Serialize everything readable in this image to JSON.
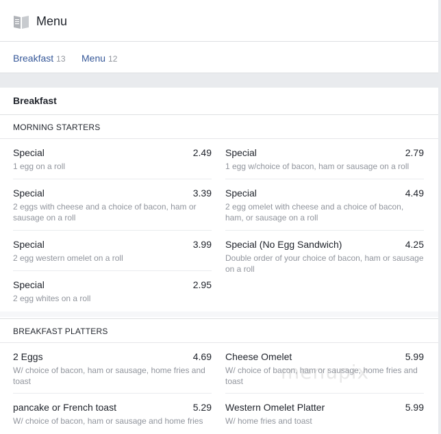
{
  "header": {
    "title": "Menu",
    "icon": "menu-book-icon"
  },
  "tabs": [
    {
      "label": "Breakfast",
      "count": "13"
    },
    {
      "label": "Menu",
      "count": "12"
    }
  ],
  "section": {
    "title": "Breakfast",
    "groups": [
      {
        "title": "MORNING STARTERS",
        "items": [
          {
            "name": "Special",
            "price": "2.49",
            "desc": "1 egg on a roll"
          },
          {
            "name": "Special",
            "price": "2.79",
            "desc": "1 egg w/choice of bacon, ham or sausage on a roll"
          },
          {
            "name": "Special",
            "price": "3.39",
            "desc": "2 eggs with cheese and a choice of bacon, ham or sausage on a roll"
          },
          {
            "name": "Special",
            "price": "4.49",
            "desc": "2 egg omelet with cheese and a choice of bacon, ham, or sausage on a roll"
          },
          {
            "name": "Special",
            "price": "3.99",
            "desc": "2 egg western omelet on a roll"
          },
          {
            "name": "Special (No Egg Sandwich)",
            "price": "4.25",
            "desc": "Double order of your choice of bacon, ham or sausage on a roll"
          },
          {
            "name": "Special",
            "price": "2.95",
            "desc": "2 egg whites on a roll"
          }
        ]
      },
      {
        "title": "BREAKFAST PLATTERS",
        "items": [
          {
            "name": "2 Eggs",
            "price": "4.69",
            "desc": "W/ choice of bacon, ham or sausage, home fries and toast"
          },
          {
            "name": "Cheese Omelet",
            "price": "5.99",
            "desc": "W/ choice of bacon, ham or sausage, home fries and toast"
          },
          {
            "name": "pancake or French toast",
            "price": "5.29",
            "desc": "W/ choice of bacon, ham or sausage and home fries"
          },
          {
            "name": "Western Omelet Platter",
            "price": "5.99",
            "desc": "W/ home fries and toast"
          }
        ]
      }
    ]
  },
  "watermark": "menupix"
}
